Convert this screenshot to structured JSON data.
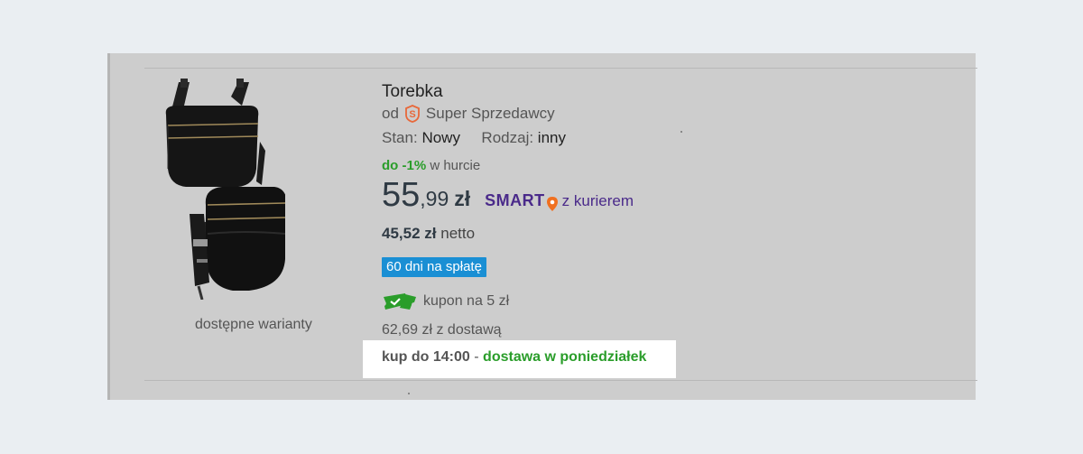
{
  "product": {
    "title": "Torebka",
    "seller_prefix": "od",
    "seller_name": "Super Sprzedawcy",
    "condition_label": "Stan:",
    "condition_value": "Nowy",
    "type_label": "Rodzaj:",
    "type_value": "inny",
    "wholesale_pct": "do -1%",
    "wholesale_text": "w hurcie",
    "price_int": "55",
    "price_dec": ",99",
    "price_currency": "zł",
    "smart_label": "SMART",
    "courier_text": "z kurierem",
    "netto_amount": "45,52 zł",
    "netto_label": "netto",
    "installments_badge": "60 dni na spłatę",
    "coupon_text": "kupon na 5 zł",
    "price_with_delivery": "62,69 zł z dostawą",
    "delivery_time": "kup do 14:00",
    "delivery_separator": "-",
    "delivery_day": "dostawa w poniedziałek",
    "variants_link": "dostępne warianty"
  },
  "colors": {
    "accent_green": "#2a9d2a",
    "smart_purple": "#4a2a8a",
    "installments_blue": "#1a8fd4",
    "seller_badge_orange": "#e8683a"
  },
  "icons": {
    "seller_badge": "super-seller-icon",
    "smart_pin": "location-pin-icon",
    "coupon": "coupon-ticket-icon"
  }
}
